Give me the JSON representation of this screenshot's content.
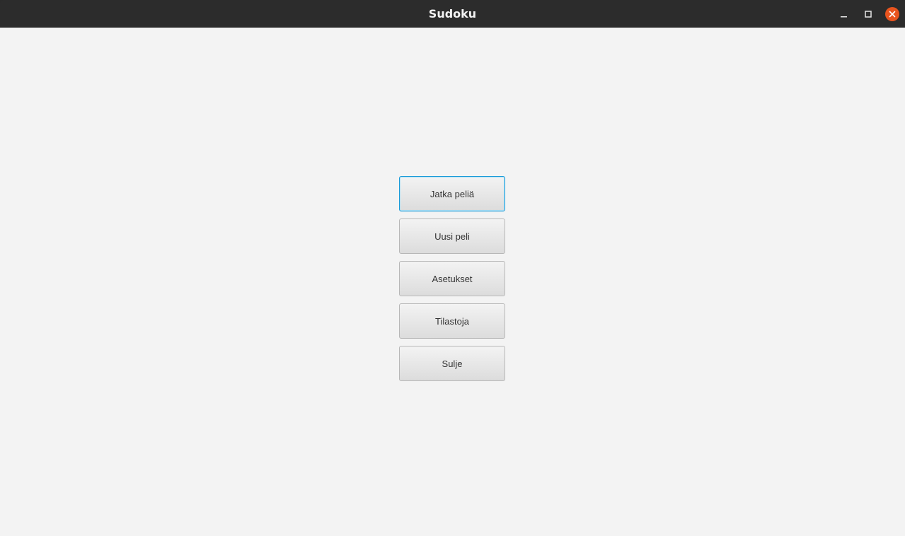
{
  "window": {
    "title": "Sudoku",
    "controls": [
      {
        "icon": "minimize-icon"
      },
      {
        "icon": "maximize-icon"
      },
      {
        "icon": "close-icon"
      }
    ],
    "close_color": "#e9541e"
  },
  "menu": {
    "items": [
      {
        "label": "Jatka peliä",
        "focused": true
      },
      {
        "label": "Uusi peli"
      },
      {
        "label": "Asetukset"
      },
      {
        "label": "Tilastoja"
      },
      {
        "label": "Sulje"
      }
    ]
  },
  "colors": {
    "background": "#f3f3f3",
    "titlebar": "#2c2c2c",
    "focus_border": "#1a9ad8"
  }
}
